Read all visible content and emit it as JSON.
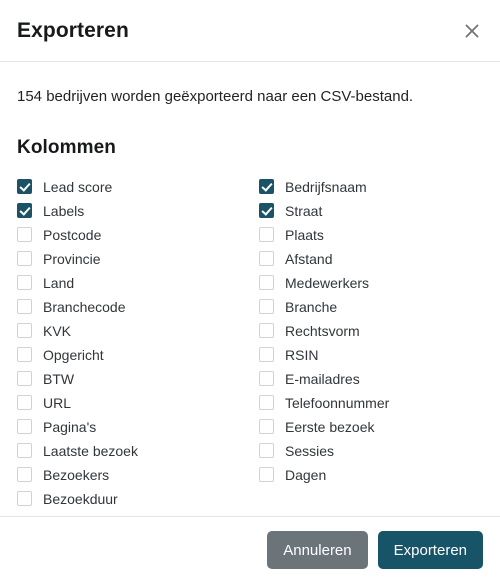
{
  "dialog": {
    "title": "Exporteren",
    "close_icon": "close-icon",
    "summary": "154 bedrijven worden geëxporteerd naar een CSV-bestand.",
    "section_title": "Kolommen",
    "record_count": "154",
    "file_format": "CSV"
  },
  "columns": {
    "left": [
      {
        "label": "Lead score",
        "checked": true
      },
      {
        "label": "Labels",
        "checked": true
      },
      {
        "label": "Postcode",
        "checked": false
      },
      {
        "label": "Provincie",
        "checked": false
      },
      {
        "label": "Land",
        "checked": false
      },
      {
        "label": "Branchecode",
        "checked": false
      },
      {
        "label": "KVK",
        "checked": false
      },
      {
        "label": "Opgericht",
        "checked": false
      },
      {
        "label": "BTW",
        "checked": false
      },
      {
        "label": "URL",
        "checked": false
      },
      {
        "label": "Pagina's",
        "checked": false
      },
      {
        "label": "Laatste bezoek",
        "checked": false
      },
      {
        "label": "Bezoekers",
        "checked": false
      },
      {
        "label": "Bezoekduur",
        "checked": false
      }
    ],
    "right": [
      {
        "label": "Bedrijfsnaam",
        "checked": true
      },
      {
        "label": "Straat",
        "checked": true
      },
      {
        "label": "Plaats",
        "checked": false
      },
      {
        "label": "Afstand",
        "checked": false
      },
      {
        "label": "Medewerkers",
        "checked": false
      },
      {
        "label": "Branche",
        "checked": false
      },
      {
        "label": "Rechtsvorm",
        "checked": false
      },
      {
        "label": "RSIN",
        "checked": false
      },
      {
        "label": "E-mailadres",
        "checked": false
      },
      {
        "label": "Telefoonnummer",
        "checked": false
      },
      {
        "label": "Eerste bezoek",
        "checked": false
      },
      {
        "label": "Sessies",
        "checked": false
      },
      {
        "label": "Dagen",
        "checked": false
      }
    ]
  },
  "footer": {
    "cancel_label": "Annuleren",
    "export_label": "Exporteren"
  },
  "theme": {
    "accent": "#1b5266",
    "primary_button": "#175467",
    "cancel_button": "#6b7479",
    "text": "#31363a",
    "border": "#e3e6e8"
  }
}
